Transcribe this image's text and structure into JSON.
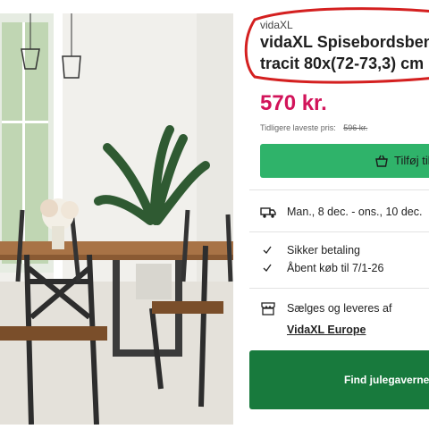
{
  "product": {
    "brand": "vidaXL",
    "title_line1": "vidaXL Spisebordsben",
    "title_line2": "tracit 80x(72-73,3) cm",
    "price": "570 kr.",
    "previous_price_label": "Tidligere laveste pris:",
    "previous_price_value": "596 kr."
  },
  "cart": {
    "button_label": "Tilføj til",
    "icon": "basket-icon"
  },
  "delivery": {
    "icon": "truck-icon",
    "text": "Man., 8 dec. - ons., 10 dec."
  },
  "benefits": [
    {
      "icon": "check-icon",
      "text": "Sikker betaling"
    },
    {
      "icon": "check-icon",
      "text": "Åbent køb til 7/1-26"
    }
  ],
  "seller": {
    "icon": "shop-icon",
    "label": "Sælges og leveres af",
    "name": "VidaXL Europe"
  },
  "promo": {
    "label": "Find julegaverne"
  },
  "colors": {
    "price": "#d2145a",
    "cart_button": "#2fb36a",
    "promo_button": "#187a3d",
    "annotation": "#d42020"
  }
}
